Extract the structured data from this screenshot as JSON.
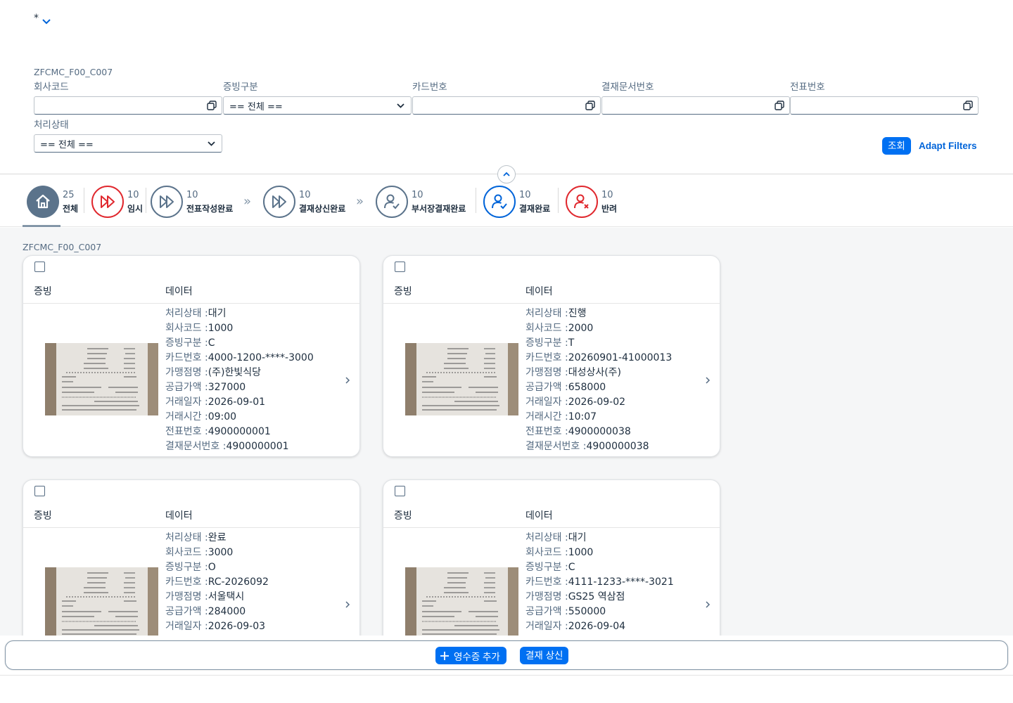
{
  "header": {
    "title": "*"
  },
  "filterbar": {
    "variant": "ZFCMC_F00_C007",
    "fields": [
      {
        "label": "회사코드",
        "value": ""
      },
      {
        "label": "증빙구분",
        "value": "== 전체 =="
      },
      {
        "label": "카드번호",
        "value": ""
      },
      {
        "label": "결재문서번호",
        "value": ""
      },
      {
        "label": "전표번호",
        "value": ""
      },
      {
        "label": "처리상태",
        "value": "== 전체 =="
      }
    ],
    "go_label": "조회",
    "adapt_label": "Adapt Filters"
  },
  "process_flow": {
    "steps": [
      {
        "count": "25",
        "label": "전체",
        "icon": "home-icon",
        "color": "#5b738b"
      },
      {
        "count": "10",
        "label": "임시",
        "icon": "double-play-icon",
        "color": "#e0282e"
      },
      {
        "count": "10",
        "label": "전표작성완료",
        "icon": "double-play-icon",
        "color": "#5b738b"
      },
      {
        "count": "10",
        "label": "결재상신완료",
        "icon": "double-play-icon",
        "color": "#5b738b"
      },
      {
        "count": "10",
        "label": "부서장결재완료",
        "icon": "user-check-icon",
        "color": "#5b738b"
      },
      {
        "count": "10",
        "label": "결재완료",
        "icon": "user-check-icon",
        "color": "#0064d9"
      },
      {
        "count": "10",
        "label": "반려",
        "icon": "user-reject-icon",
        "color": "#e0282e"
      }
    ],
    "arrow": "»"
  },
  "content": {
    "title": "ZFCMC_F00_C007",
    "col_evidence": "증빙",
    "col_data": "데이터",
    "cards": [
      {
        "rows": [
          {
            "k": "처리상태 :",
            "v": "대기"
          },
          {
            "k": "회사코드 :",
            "v": "1000"
          },
          {
            "k": "증빙구분 :",
            "v": "C"
          },
          {
            "k": "카드번호 :",
            "v": "4000-1200-****-3000"
          },
          {
            "k": "가맹점명 :",
            "v": "(주)한빛식당"
          },
          {
            "k": "공급가액 :",
            "v": "327000"
          },
          {
            "k": "거래일자 :",
            "v": "2026-09-01"
          },
          {
            "k": "거래시간 :",
            "v": "09:00"
          },
          {
            "k": "전표번호 :",
            "v": "4900000001"
          },
          {
            "k": "결재문서번호 :",
            "v": "4900000001"
          }
        ]
      },
      {
        "rows": [
          {
            "k": "처리상태 :",
            "v": "진행"
          },
          {
            "k": "회사코드 :",
            "v": "2000"
          },
          {
            "k": "증빙구분 :",
            "v": "T"
          },
          {
            "k": "카드번호 :",
            "v": "20260901-41000013"
          },
          {
            "k": "가맹점명 :",
            "v": "대성상사(주)"
          },
          {
            "k": "공급가액 :",
            "v": "658000"
          },
          {
            "k": "거래일자 :",
            "v": "2026-09-02"
          },
          {
            "k": "거래시간 :",
            "v": "10:07"
          },
          {
            "k": "전표번호 :",
            "v": "4900000038"
          },
          {
            "k": "결재문서번호 :",
            "v": "4900000038"
          }
        ]
      },
      {
        "rows": [
          {
            "k": "처리상태 :",
            "v": "완료"
          },
          {
            "k": "회사코드 :",
            "v": "3000"
          },
          {
            "k": "증빙구분 :",
            "v": "O"
          },
          {
            "k": "카드번호 :",
            "v": "RC-2026092"
          },
          {
            "k": "가맹점명 :",
            "v": "서울택시"
          },
          {
            "k": "공급가액 :",
            "v": "284000"
          },
          {
            "k": "거래일자 :",
            "v": "2026-09-03"
          }
        ]
      },
      {
        "rows": [
          {
            "k": "처리상태 :",
            "v": "대기"
          },
          {
            "k": "회사코드 :",
            "v": "1000"
          },
          {
            "k": "증빙구분 :",
            "v": "C"
          },
          {
            "k": "카드번호 :",
            "v": "4111-1233-****-3021"
          },
          {
            "k": "가맹점명 :",
            "v": "GS25 역삼점"
          },
          {
            "k": "공급가액 :",
            "v": "550000"
          },
          {
            "k": "거래일자 :",
            "v": "2026-09-04"
          }
        ]
      }
    ]
  },
  "footer": {
    "add_label": "영수증 추가",
    "submit_label": "결재 상신"
  }
}
